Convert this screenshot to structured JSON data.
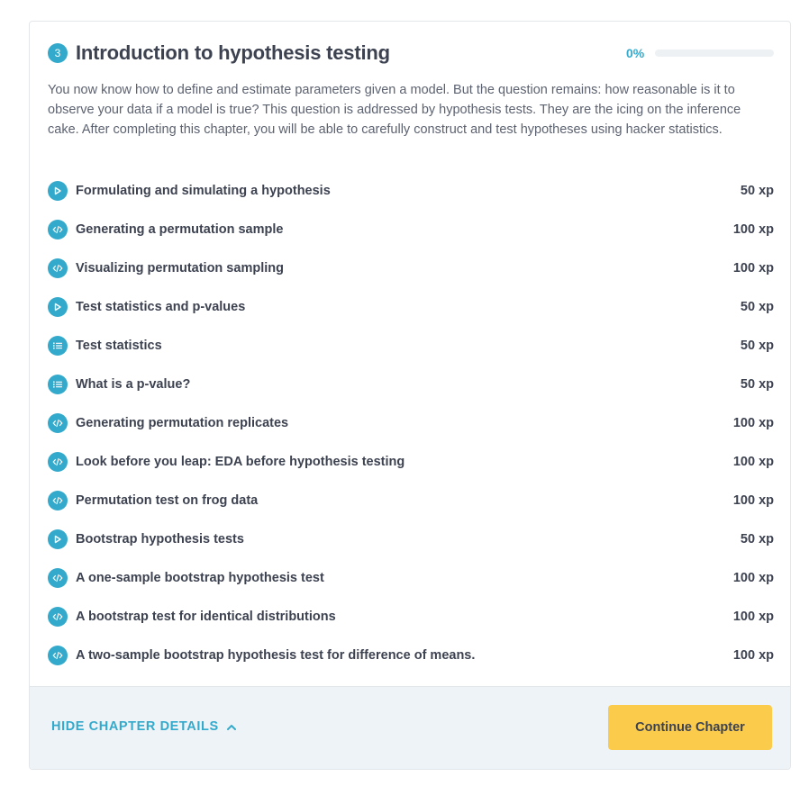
{
  "chapter": {
    "number": "3",
    "title": "Introduction to hypothesis testing",
    "progress_label": "0%",
    "progress_fraction": 0,
    "description": "You now know how to define and estimate parameters given a model. But the question remains: how reasonable is it to observe your data if a model is true? This question is addressed by hypothesis tests. They are the icing on the inference cake. After completing this chapter, you will be able to carefully construct and test hypotheses using hacker statistics."
  },
  "exercises": [
    {
      "title": "Formulating and simulating a hypothesis",
      "xp": "50 xp",
      "icon": "video-play-icon"
    },
    {
      "title": "Generating a permutation sample",
      "xp": "100 xp",
      "icon": "code-icon"
    },
    {
      "title": "Visualizing permutation sampling",
      "xp": "100 xp",
      "icon": "code-icon"
    },
    {
      "title": "Test statistics and p-values",
      "xp": "50 xp",
      "icon": "video-play-icon"
    },
    {
      "title": "Test statistics",
      "xp": "50 xp",
      "icon": "multiple-choice-icon"
    },
    {
      "title": "What is a p-value?",
      "xp": "50 xp",
      "icon": "multiple-choice-icon"
    },
    {
      "title": "Generating permutation replicates",
      "xp": "100 xp",
      "icon": "code-icon"
    },
    {
      "title": "Look before you leap: EDA before hypothesis testing",
      "xp": "100 xp",
      "icon": "code-icon"
    },
    {
      "title": "Permutation test on frog data",
      "xp": "100 xp",
      "icon": "code-icon"
    },
    {
      "title": "Bootstrap hypothesis tests",
      "xp": "50 xp",
      "icon": "video-play-icon"
    },
    {
      "title": "A one-sample bootstrap hypothesis test",
      "xp": "100 xp",
      "icon": "code-icon"
    },
    {
      "title": "A bootstrap test for identical distributions",
      "xp": "100 xp",
      "icon": "code-icon"
    },
    {
      "title": "A two-sample bootstrap hypothesis test for difference of means.",
      "xp": "100 xp",
      "icon": "code-icon"
    }
  ],
  "footer": {
    "hide_details_label": "HIDE CHAPTER DETAILS",
    "continue_label": "Continue Chapter"
  },
  "colors": {
    "accent": "#33aacc",
    "button": "#fbcb4b",
    "text": "#3d4251"
  }
}
